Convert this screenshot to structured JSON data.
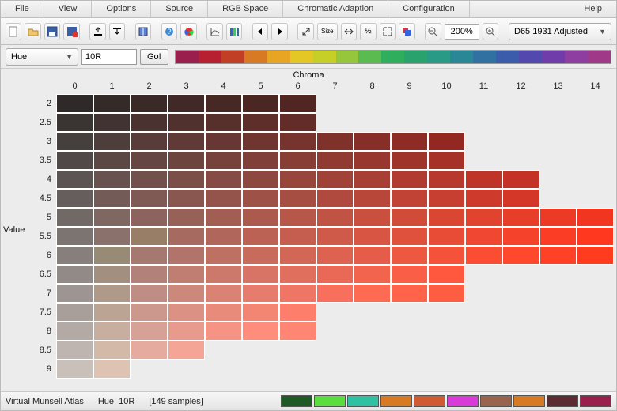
{
  "menu": [
    "File",
    "View",
    "Options",
    "Source",
    "RGB Space",
    "Chromatic Adaption",
    "Configuration",
    "Help"
  ],
  "toolbar": {
    "zoom": "200%",
    "selectedProfile": "D65 1931 Adjusted"
  },
  "hue": {
    "selector_label": "Hue",
    "input_value": "10R",
    "go_label": "Go!"
  },
  "hue_strip_colors": [
    "#9a1f4c",
    "#b62030",
    "#c13f24",
    "#d87a24",
    "#e8a524",
    "#e4c624",
    "#c6ce28",
    "#96c63c",
    "#5cbb50",
    "#2fae5e",
    "#2aa26e",
    "#289a86",
    "#2a8796",
    "#3071a2",
    "#3a5cab",
    "#5248ad",
    "#703ca9",
    "#8e3da0",
    "#a03a88"
  ],
  "axes": {
    "x_title": "Chroma",
    "y_title": "Value"
  },
  "x_ticks": [
    "0",
    "1",
    "2",
    "3",
    "4",
    "5",
    "6",
    "7",
    "8",
    "9",
    "10",
    "11",
    "12",
    "13",
    "14"
  ],
  "y_ticks": [
    "2",
    "2.5",
    "3",
    "3.5",
    "4",
    "4.5",
    "5",
    "5.5",
    "6",
    "6.5",
    "7",
    "7.5",
    "8",
    "8.5",
    "9"
  ],
  "status": {
    "app": "Virtual Munsell Atlas",
    "hue": "Hue: 10R",
    "samples": "[149 samples]"
  },
  "status_swatches": [
    "#1f5a26",
    "#5ade3d",
    "#2fc2a2",
    "#d87a24",
    "#d05a32",
    "#d83bd8",
    "#99644d",
    "#d87a24",
    "#5b2d33",
    "#9a1f4c"
  ],
  "chart_data": {
    "type": "heatmap",
    "title": "Munsell Hue 10R — Value × Chroma",
    "xlabel": "Chroma",
    "ylabel": "Value",
    "x": [
      0,
      1,
      2,
      3,
      4,
      5,
      6,
      7,
      8,
      9,
      10,
      11,
      12,
      13,
      14
    ],
    "y": [
      2,
      2.5,
      3,
      3.5,
      4,
      4.5,
      5,
      5.5,
      6,
      6.5,
      7,
      7.5,
      8,
      8.5,
      9
    ],
    "chroma_max_by_value": {
      "2": 6,
      "2.5": 6,
      "3": 10,
      "3.5": 10,
      "4": 12,
      "4.5": 12,
      "5": 14,
      "5.5": 14,
      "6": 14,
      "6.5": 10,
      "7": 10,
      "7.5": 6,
      "8": 6,
      "8.5": 3,
      "9": 1
    },
    "colors": [
      [
        "#2f2a29",
        "#342a28",
        "#3a2a27",
        "#402926",
        "#462825",
        "#4b2724",
        "#512522"
      ],
      [
        "#3a3433",
        "#413332",
        "#493230",
        "#50312e",
        "#57302c",
        "#5e2e2a",
        "#642c28"
      ],
      [
        "#453f3d",
        "#4e3e3b",
        "#573c39",
        "#5f3a36",
        "#673833",
        "#6f3630",
        "#77332d",
        "#7f312a",
        "#862e27",
        "#8d2b24",
        "#932822"
      ],
      [
        "#504947",
        "#5b4845",
        "#654642",
        "#6e443f",
        "#77423c",
        "#803f38",
        "#883d35",
        "#903a31",
        "#98372e",
        "#9f342a",
        "#a63127"
      ],
      [
        "#5b5452",
        "#67524f",
        "#72504b",
        "#7c4e48",
        "#864b44",
        "#8f4840",
        "#98453c",
        "#a04238",
        "#a83f34",
        "#b03b30",
        "#b7382c",
        "#be3428",
        "#c43125"
      ],
      [
        "#665e5c",
        "#735c58",
        "#7f5a54",
        "#8a5750",
        "#94544b",
        "#9e5147",
        "#a74e42",
        "#b04a3e",
        "#b84739",
        "#c04335",
        "#c73f30",
        "#ce3b2c",
        "#d43728"
      ],
      [
        "#716966",
        "#7f6762",
        "#8c645d",
        "#986158",
        "#a35e53",
        "#ad5a4e",
        "#b75749",
        "#c05343",
        "#c94f3e",
        "#d14b39",
        "#d94733",
        "#e0432e",
        "#e63e29",
        "#ec3a24",
        "#f2351f"
      ],
      [
        "#7c7471",
        "#8b716c",
        "#997e67",
        "#a66a61",
        "#b1665b",
        "#bc6255",
        "#c65e4f",
        "#cf5a49",
        "#d85543",
        "#e0513d",
        "#e84c37",
        "#ef4731",
        "#f5422b",
        "#fb3d25",
        "#ff381f"
      ],
      [
        "#877f7b",
        "#978b76",
        "#a57870",
        "#b2746a",
        "#be7063",
        "#c96b5c",
        "#d36756",
        "#dd624f",
        "#e55d48",
        "#ed5841",
        "#f4533a",
        "#fb4d33",
        "#ff482c",
        "#ff4225",
        "#ff3c1e"
      ],
      [
        "#928a86",
        "#a38f80",
        "#b2827a",
        "#c07e73",
        "#cc796c",
        "#d77465",
        "#e16f5d",
        "#ea6956",
        "#f3644e",
        "#fb5e46",
        " #ff583f"
      ],
      [
        "#9d9591",
        "#af9a8a",
        "#bf8d83",
        "#cd887c",
        "#da8274",
        "#e57c6c",
        "#ef7664",
        "#f8705b",
        "#ff6a53",
        "#ff644a",
        "#ff5d42"
      ],
      [
        "#a89f9b",
        "#bba494",
        "#cc978c",
        "#db9184",
        "#e88b7b",
        " #f38573",
        "#fd7e6a"
      ],
      [
        "#b3aaa6",
        "#c7ae9e",
        "#d8a196",
        "#e89b8d",
        "#f59484",
        "#ff8d7b",
        "#ff8672"
      ],
      [
        "#beb5b0",
        "#d3b9a8",
        "#e5ab9f",
        "#f5a596"
      ],
      [
        "#c9c0ba",
        "#dfc3b2"
      ]
    ]
  }
}
